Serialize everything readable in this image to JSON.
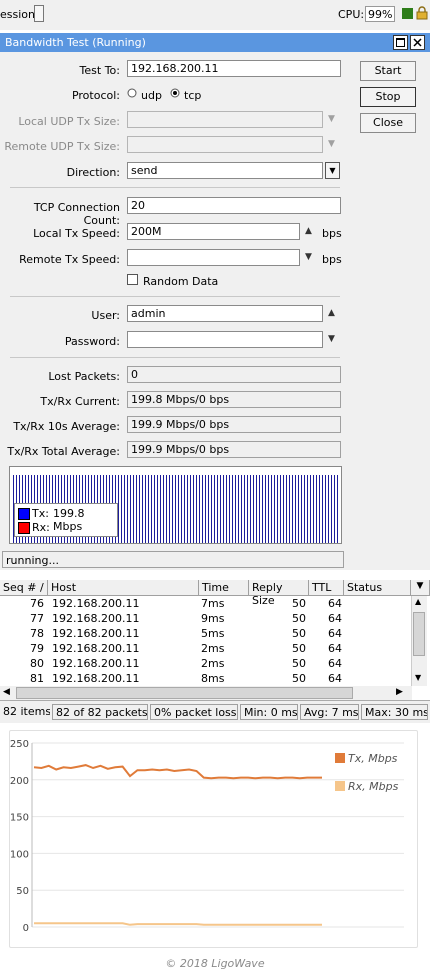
{
  "topbar": {
    "session_label": "ession:",
    "cpu_label": "CPU:",
    "cpu_value": "99%"
  },
  "window": {
    "title": "Bandwidth Test (Running)"
  },
  "form": {
    "test_to": {
      "label": "Test To:",
      "value": "192.168.200.11"
    },
    "protocol": {
      "label": "Protocol:",
      "options": [
        "udp",
        "tcp"
      ],
      "selected": "tcp"
    },
    "local_udp": {
      "label": "Local UDP Tx Size:"
    },
    "remote_udp": {
      "label": "Remote UDP Tx Size:"
    },
    "direction": {
      "label": "Direction:",
      "value": "send"
    },
    "tcp_conn": {
      "label": "TCP Connection Count:",
      "value": "20"
    },
    "local_tx": {
      "label": "Local Tx Speed:",
      "value": "200M",
      "unit": "bps"
    },
    "remote_tx": {
      "label": "Remote Tx Speed:",
      "unit": "bps"
    },
    "random_data": {
      "label": "Random Data",
      "checked": false
    },
    "user": {
      "label": "User:",
      "value": "admin"
    },
    "password": {
      "label": "Password:"
    },
    "lost_packets": {
      "label": "Lost Packets:",
      "value": "0"
    },
    "txrx_current": {
      "label": "Tx/Rx Current:",
      "value": "199.8 Mbps/0 bps"
    },
    "txrx_10s": {
      "label": "Tx/Rx 10s Average:",
      "value": "199.9 Mbps/0 bps"
    },
    "txrx_total": {
      "label": "Tx/Rx Total Average:",
      "value": "199.9 Mbps/0 bps"
    }
  },
  "buttons": {
    "start": "Start",
    "stop": "Stop",
    "close": "Close"
  },
  "mini_graph": {
    "tx_label": "Tx:",
    "tx_value": "199.8 Mbps",
    "rx_label": "Rx:",
    "tx_color": "#0000ff",
    "rx_color": "#ff0000"
  },
  "status_text": "running...",
  "ping_table": {
    "columns": [
      "Seq # /",
      "Host",
      "Time",
      "Reply Size",
      "TTL",
      "Status"
    ],
    "rows": [
      {
        "seq": "76",
        "host": "192.168.200.11",
        "time": "7ms",
        "size": "50",
        "ttl": "64",
        "status": ""
      },
      {
        "seq": "77",
        "host": "192.168.200.11",
        "time": "9ms",
        "size": "50",
        "ttl": "64",
        "status": ""
      },
      {
        "seq": "78",
        "host": "192.168.200.11",
        "time": "5ms",
        "size": "50",
        "ttl": "64",
        "status": ""
      },
      {
        "seq": "79",
        "host": "192.168.200.11",
        "time": "2ms",
        "size": "50",
        "ttl": "64",
        "status": ""
      },
      {
        "seq": "80",
        "host": "192.168.200.11",
        "time": "2ms",
        "size": "50",
        "ttl": "64",
        "status": ""
      },
      {
        "seq": "81",
        "host": "192.168.200.11",
        "time": "8ms",
        "size": "50",
        "ttl": "64",
        "status": ""
      }
    ]
  },
  "statusbar": {
    "items": "82 items",
    "packets": "82 of 82 packets ...",
    "loss": "0% packet loss",
    "min": "Min: 0 ms",
    "avg": "Avg: 7 ms",
    "max": "Max: 30 ms"
  },
  "chart_data": {
    "type": "line",
    "yticks": [
      "0",
      "50",
      "100",
      "150",
      "200",
      "250"
    ],
    "ylim": [
      0,
      250
    ],
    "series": [
      {
        "name": "Tx, Mbps",
        "color": "#e07b39",
        "values": [
          217,
          216,
          219,
          214,
          217,
          216,
          218,
          220,
          216,
          219,
          215,
          217,
          218,
          205,
          213,
          213,
          214,
          213,
          214,
          212,
          213,
          214,
          212,
          203,
          202,
          203,
          203,
          202,
          203,
          203,
          202,
          203,
          203,
          202,
          203,
          203,
          202,
          203,
          203,
          203
        ]
      },
      {
        "name": "Rx, Mbps",
        "color": "#f5c58a",
        "values": [
          5,
          5,
          5,
          5,
          5,
          5,
          5,
          5,
          5,
          5,
          5,
          5,
          5,
          3,
          4,
          4,
          4,
          4,
          4,
          4,
          4,
          4,
          4,
          3,
          3,
          3,
          3,
          3,
          3,
          3,
          3,
          3,
          3,
          3,
          3,
          3,
          3,
          3,
          3,
          3
        ]
      }
    ]
  },
  "credit": "© 2018 LigoWave"
}
